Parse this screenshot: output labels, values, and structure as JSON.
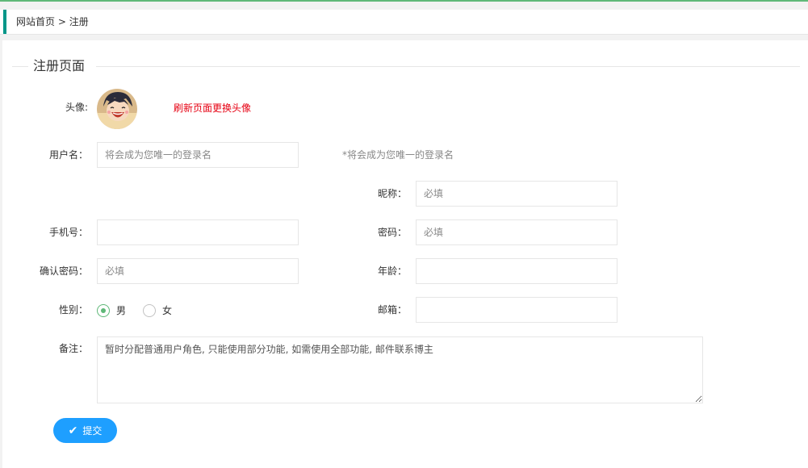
{
  "breadcrumb": {
    "home": "网站首页",
    "separator": ">",
    "current": "注册"
  },
  "form": {
    "legend": "注册页面",
    "avatar": {
      "label": "头像:",
      "refresh_tip": "刷新页面更换头像"
    },
    "username": {
      "label": "用户名：",
      "placeholder": "将会成为您唯一的登录名",
      "value": "",
      "hint": "*将会成为您唯一的登录名"
    },
    "nickname": {
      "label": "昵称：",
      "placeholder": "必填",
      "value": ""
    },
    "phone": {
      "label": "手机号：",
      "placeholder": "",
      "value": ""
    },
    "password": {
      "label": "密码：",
      "placeholder": "必填",
      "value": ""
    },
    "confirm_password": {
      "label": "确认密码：",
      "placeholder": "必填",
      "value": ""
    },
    "age": {
      "label": "年龄：",
      "placeholder": "",
      "value": ""
    },
    "gender": {
      "label": "性别：",
      "options": [
        "男",
        "女"
      ],
      "selected": "男"
    },
    "email": {
      "label": "邮箱：",
      "placeholder": "",
      "value": ""
    },
    "remark": {
      "label": "备注：",
      "placeholder": "暂时分配普通用户角色, 只能使用部分功能, 如需使用全部功能, 邮件联系博主"
    },
    "submit": {
      "label": "提交",
      "icon": "check-icon"
    }
  },
  "colors": {
    "accent_teal": "#009688",
    "radio_green": "#5fb878",
    "button_blue": "#1e9fff",
    "tip_red": "#e60012"
  }
}
